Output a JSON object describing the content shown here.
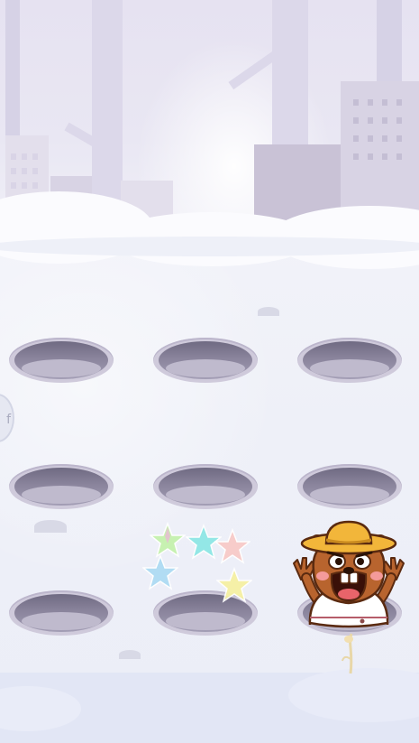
{
  "game": {
    "title": "",
    "side_tab_glyph": "f",
    "grid": {
      "rows": 3,
      "cols": 3
    },
    "holes": [
      {
        "row": 1,
        "col": 1,
        "occupant": "empty"
      },
      {
        "row": 1,
        "col": 2,
        "occupant": "empty"
      },
      {
        "row": 1,
        "col": 3,
        "occupant": "empty"
      },
      {
        "row": 2,
        "col": 1,
        "occupant": "empty"
      },
      {
        "row": 2,
        "col": 2,
        "occupant": "empty"
      },
      {
        "row": 2,
        "col": 3,
        "occupant": "empty"
      },
      {
        "row": 3,
        "col": 1,
        "occupant": "empty"
      },
      {
        "row": 3,
        "col": 2,
        "occupant": "empty"
      },
      {
        "row": 3,
        "col": 3,
        "occupant": "beaver"
      }
    ],
    "stars": [
      {
        "color": "#bff0a8",
        "name": "green-star-icon"
      },
      {
        "color": "#8fe6e8",
        "name": "cyan-star-icon"
      },
      {
        "color": "#f7c6c6",
        "name": "pink-star-icon"
      },
      {
        "color": "#a8d8f0",
        "name": "blue-star-icon"
      },
      {
        "color": "#f5f0a0",
        "name": "yellow-star-icon"
      }
    ],
    "character": {
      "name": "beaver-with-hat",
      "hat_color": "#f2b63a",
      "fur_color": "#b8642e"
    },
    "colors": {
      "sky": "#e6e2f1",
      "snow": "#eef0f8",
      "hole_dark": "#6f6a82",
      "building": "#d0cbdd"
    }
  }
}
